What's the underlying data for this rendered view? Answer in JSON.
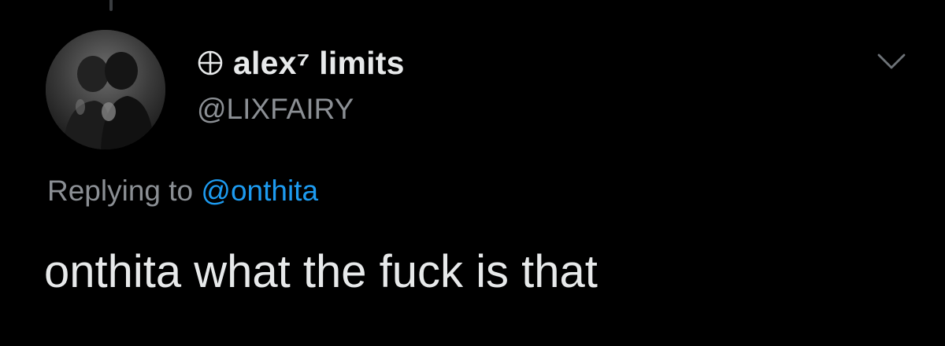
{
  "tweet": {
    "display_name": "alex⁷ limits",
    "handle": "@LIXFAIRY",
    "replying_prefix": "Replying to",
    "replying_to": "@onthita",
    "text": "onthita what the fuck is that",
    "avatar_icon": "profile-photo-avatar",
    "name_icon": "circle-plus-globe-icon",
    "menu_icon": "chevron-down-icon"
  },
  "colors": {
    "background": "#000000",
    "primary_text": "#e7e9ea",
    "secondary_text": "#8b8f94",
    "link": "#1d9bf0"
  }
}
